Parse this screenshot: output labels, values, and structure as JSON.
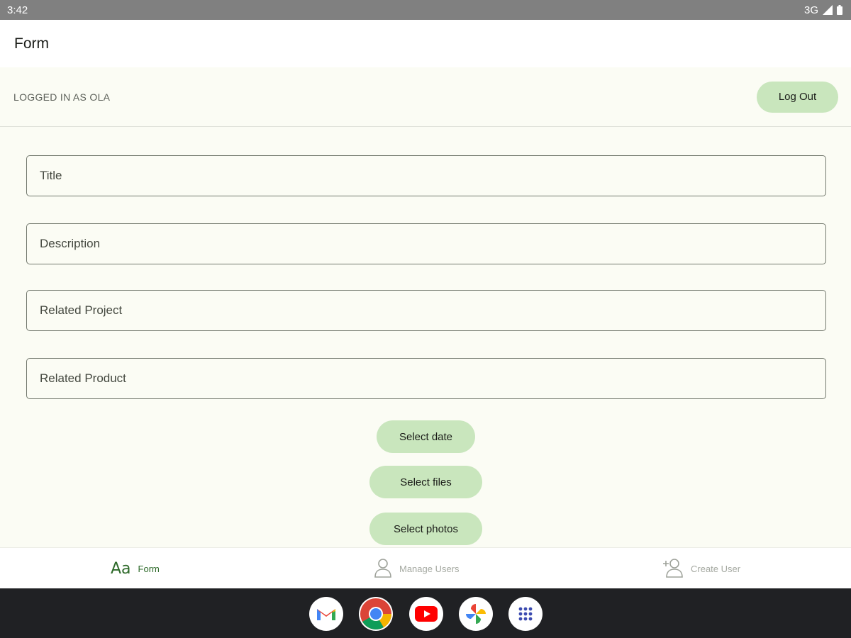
{
  "status_bar": {
    "time": "3:42",
    "network": "3G"
  },
  "app_bar": {
    "title": "Form"
  },
  "account": {
    "label": "LOGGED IN AS OLA",
    "logout_label": "Log Out"
  },
  "form": {
    "title_placeholder": "Title",
    "description_placeholder": "Description",
    "related_project_placeholder": "Related Project",
    "related_product_placeholder": "Related Product",
    "select_date_label": "Select date",
    "select_files_label": "Select files",
    "select_photos_label": "Select photos"
  },
  "bottom_nav": {
    "items": [
      {
        "icon": "aa-text-icon",
        "glyph": "Aa",
        "label": "Form",
        "active": true
      },
      {
        "icon": "person-icon",
        "label": "Manage Users",
        "active": false
      },
      {
        "icon": "person-add-icon",
        "label": "Create User",
        "active": false
      }
    ]
  },
  "dock": {
    "apps": [
      "gmail-icon",
      "chrome-icon",
      "youtube-icon",
      "photos-icon",
      "app-drawer-icon"
    ]
  },
  "colors": {
    "accent_green": "#2e6a2a",
    "pill_bg": "#c9e6bd",
    "background": "#fbfcf4"
  }
}
